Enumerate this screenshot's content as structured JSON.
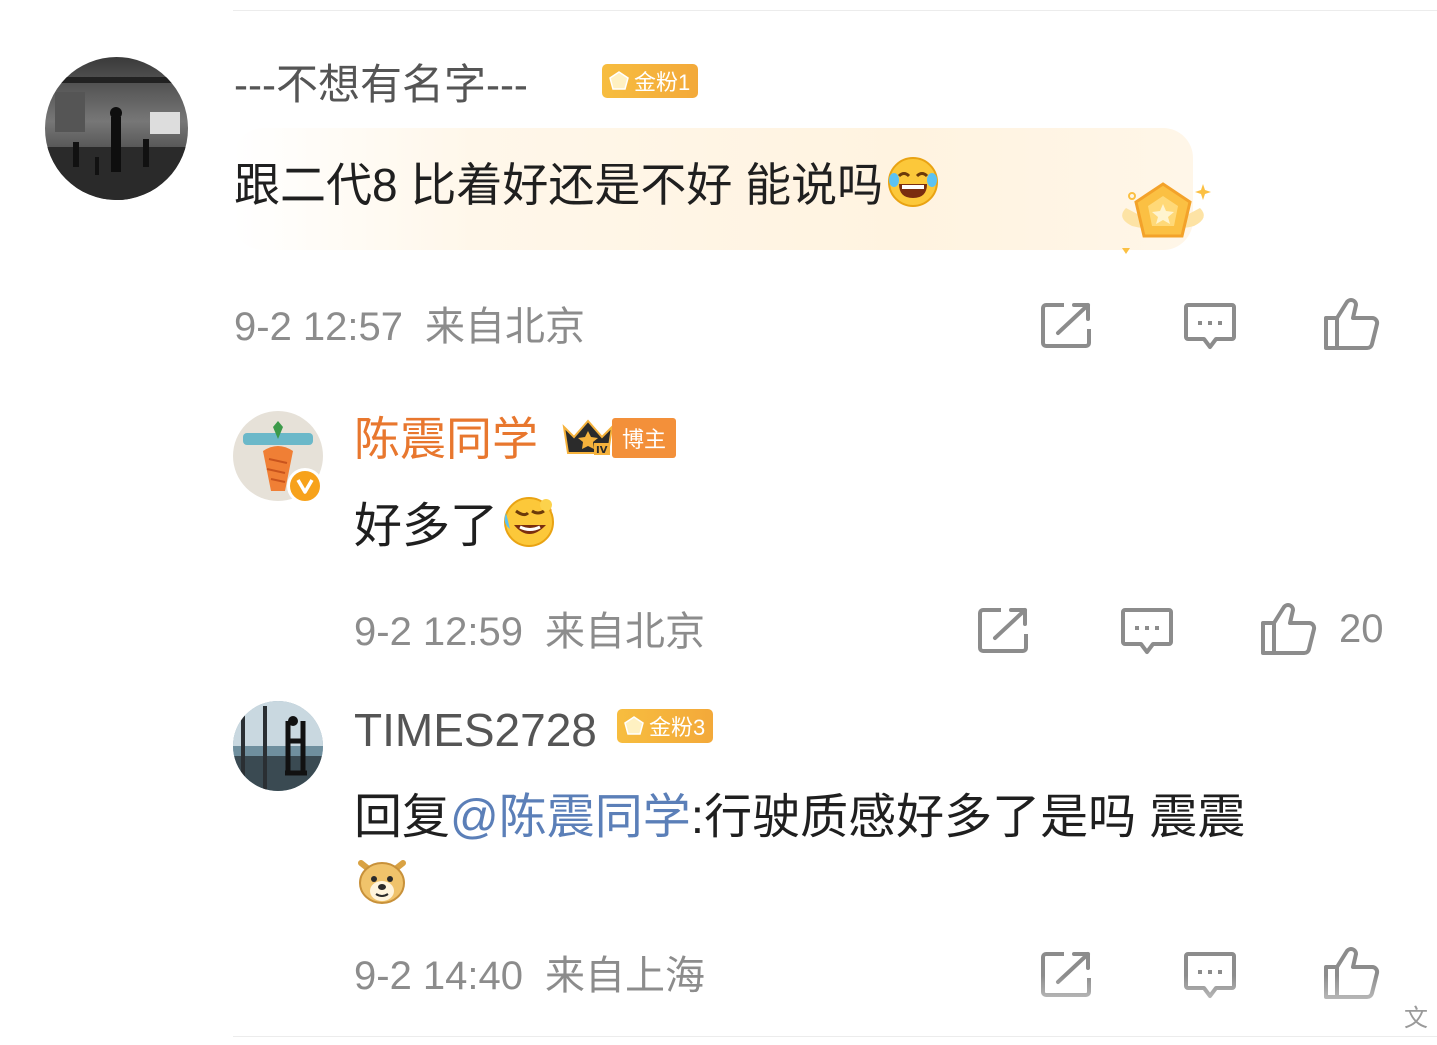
{
  "comments": [
    {
      "username": "---不想有名字---",
      "badge": "金粉1",
      "text": "跟二代8 比着好还是不好 能说吗",
      "time": "9-2 12:57",
      "location": "来自北京",
      "likes": ""
    },
    {
      "username": "陈震同学",
      "badge": "博主",
      "badge_level": "IV",
      "text": "好多了",
      "time": "9-2 12:59",
      "location": "来自北京",
      "likes": "20"
    },
    {
      "username": "TIMES2728",
      "badge": "金粉3",
      "reply_prefix": "回复",
      "mention": "@陈震同学",
      "text_after": ":行驶质感好多了是吗 震震",
      "time": "9-2 14:40",
      "location": "来自上海",
      "likes": ""
    }
  ],
  "bottom_partial": "文",
  "icons": {
    "share": "share-icon",
    "comment": "comment-icon",
    "like": "thumbs-up-icon",
    "emoji_laugh": "laughing-tears-emoji",
    "emoji_cry_laugh": "rolling-laugh-emoji",
    "emoji_doge": "doge-emoji",
    "verified": "verified-v-icon",
    "crown": "crown-icon"
  },
  "colors": {
    "username_default": "#555555",
    "username_blogger": "#e8772e",
    "mention": "#5b7fb8",
    "meta_gray": "#8c8c8c",
    "badge_gold": "#f5b23c",
    "highlight_bg": "#fff4e3"
  }
}
